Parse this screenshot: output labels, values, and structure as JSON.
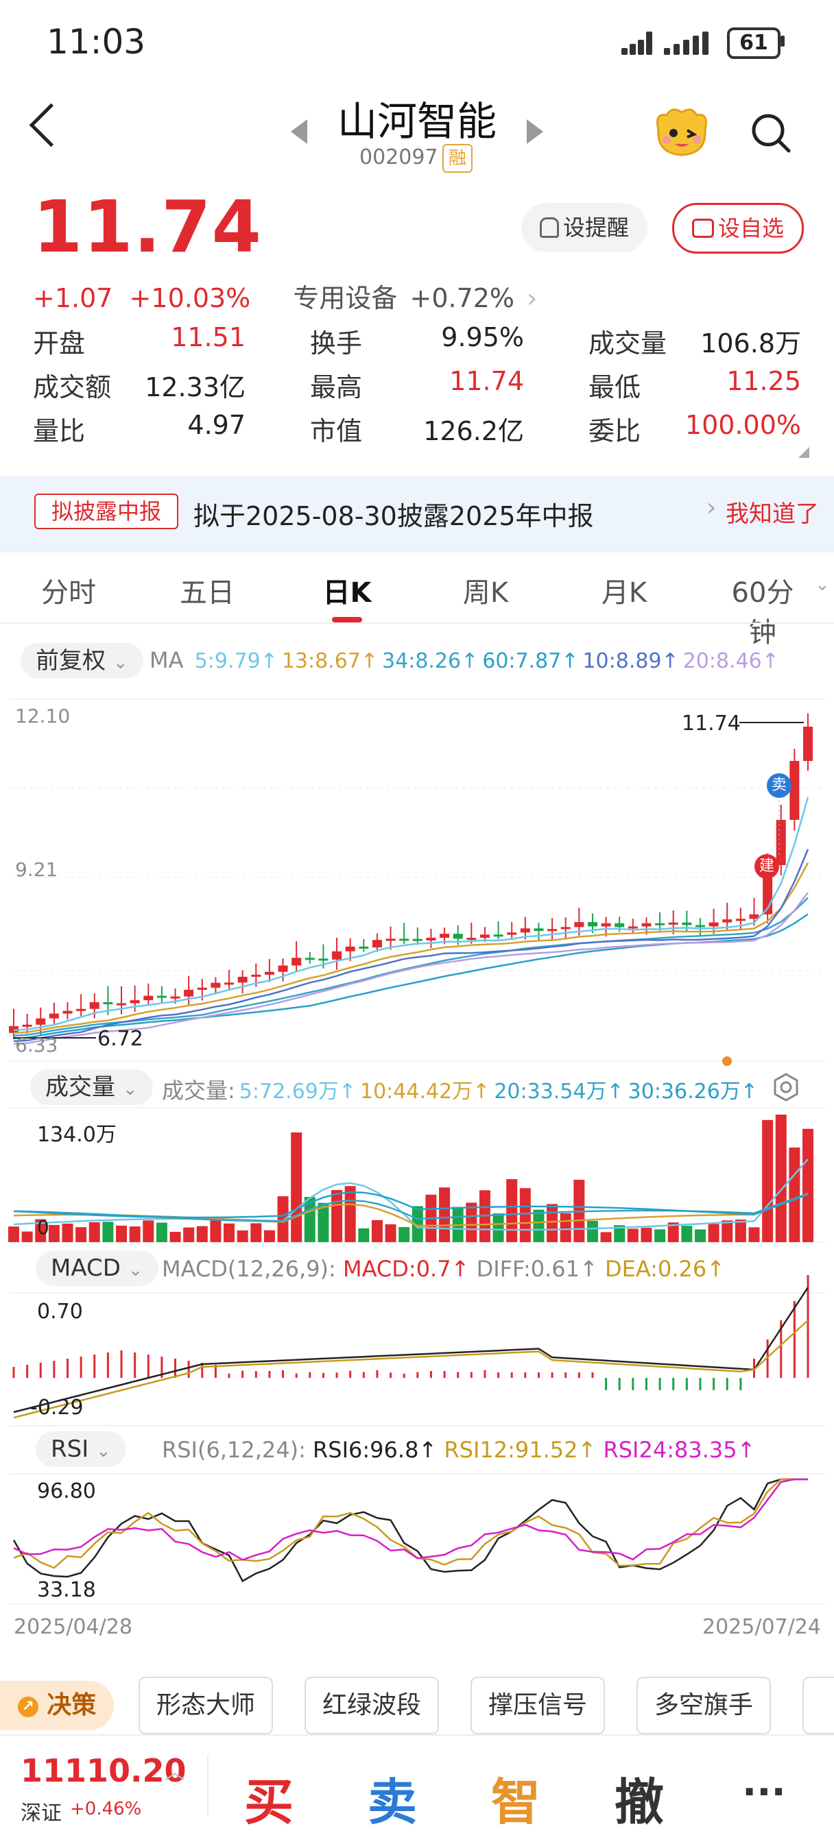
{
  "status_bar": {
    "time": "11:03",
    "battery": "61"
  },
  "header": {
    "title": "山河智能",
    "code": "002097",
    "margin_tag": "融"
  },
  "quote": {
    "price": "11.74",
    "change": "+1.07",
    "change_pct": "+10.03%",
    "sector": "专用设备",
    "sector_pct": "+0.72%",
    "alert_label": "设提醒",
    "fav_label": "设自选"
  },
  "stats": [
    {
      "label": "开盘",
      "value": "11.51",
      "color": "#e02a2f"
    },
    {
      "label": "换手",
      "value": "9.95%",
      "color": "#222222"
    },
    {
      "label": "成交量",
      "value": "106.8万",
      "color": "#222222"
    },
    {
      "label": "成交额",
      "value": "12.33亿",
      "color": "#222222"
    },
    {
      "label": "最高",
      "value": "11.74",
      "color": "#e02a2f"
    },
    {
      "label": "最低",
      "value": "11.25",
      "color": "#e02a2f"
    },
    {
      "label": "量比",
      "value": "4.97",
      "color": "#222222"
    },
    {
      "label": "市值",
      "value": "126.2亿",
      "color": "#222222"
    },
    {
      "label": "委比",
      "value": "100.00%",
      "color": "#e02a2f"
    }
  ],
  "notice": {
    "tag": "拟披露中报",
    "text": "拟于2025-08-30披露2025年中报",
    "action": "我知道了"
  },
  "tabs": [
    "分时",
    "五日",
    "日K",
    "周K",
    "月K",
    "60分钟"
  ],
  "active_tab": "日K",
  "kline": {
    "adjust": "前复权",
    "ma_label": "MA",
    "ma": [
      {
        "text": "5:9.79↑",
        "color": "#6cc7ea"
      },
      {
        "text": "13:8.67↑",
        "color": "#d6a12d"
      },
      {
        "text": "34:8.26↑",
        "color": "#36a3c9"
      },
      {
        "text": "60:7.87↑",
        "color": "#28a0c8"
      },
      {
        "text": "10:8.89↑",
        "color": "#4e72c9"
      },
      {
        "text": "20:8.46↑",
        "color": "#b99ee0"
      }
    ],
    "y_top": "12.10",
    "y_mid": "9.21",
    "y_bottom": "6.33",
    "last_label": "11.74",
    "low_label": "6.72",
    "sell_marker": "卖",
    "build_marker": "建"
  },
  "volume": {
    "label": "成交量",
    "prefix": "成交量:",
    "ma": [
      {
        "text": "5:72.69万↑",
        "color": "#6cc7ea"
      },
      {
        "text": "10:44.42万↑",
        "color": "#d6a12d"
      },
      {
        "text": "20:33.54万↑",
        "color": "#36a3c9"
      },
      {
        "text": "30:36.26万↑",
        "color": "#28a0c8"
      }
    ],
    "y_top": "134.0万",
    "y_zero": "0"
  },
  "macd": {
    "label": "MACD",
    "params": "MACD(12,26,9):",
    "macd": "MACD:0.7↑",
    "diff": "DIFF:0.61↑",
    "dea": "DEA:0.26↑",
    "y_top": "0.70",
    "y_bottom": "-0.29"
  },
  "rsi": {
    "label": "RSI",
    "params": "RSI(6,12,24):",
    "rsi6": "RSI6:96.8↑",
    "rsi12": "RSI12:91.52↑",
    "rsi24": "RSI24:83.35↑",
    "y_top": "96.80",
    "y_bottom": "33.18"
  },
  "dates": {
    "start": "2025/04/28",
    "end": "2025/07/24"
  },
  "tools": {
    "juece": "决策",
    "items": [
      "形态大师",
      "红绿波段",
      "撑压信号",
      "多空旗手"
    ]
  },
  "bottom": {
    "index_value": "11110.20",
    "index_name": "深证",
    "index_pct": "+0.46%",
    "buy": "买",
    "sell": "卖",
    "smart": "智",
    "cancel": "撤",
    "more": "···"
  },
  "colors": {
    "up": "#e02a2f",
    "down": "#1aa54a",
    "accent_blue": "#2b7bd6",
    "orange": "#e8932b"
  }
}
